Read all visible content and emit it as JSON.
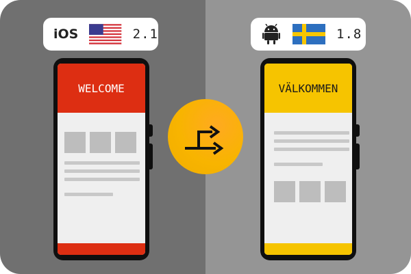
{
  "left": {
    "platform_label": "iOS",
    "flag_icon": "us-flag-icon",
    "version": "2.1",
    "screen_title": "WELCOME",
    "accent_color": "#dd2e12"
  },
  "right": {
    "platform_icon": "android-icon",
    "flag_icon": "sweden-flag-icon",
    "version": "1.8",
    "screen_title": "VÄLKOMMEN",
    "accent_color": "#f6c400"
  },
  "center": {
    "icon": "translate-arrows-icon",
    "color": "#f8b400"
  },
  "colors": {
    "left_background": "#707070",
    "right_background": "#959595"
  }
}
